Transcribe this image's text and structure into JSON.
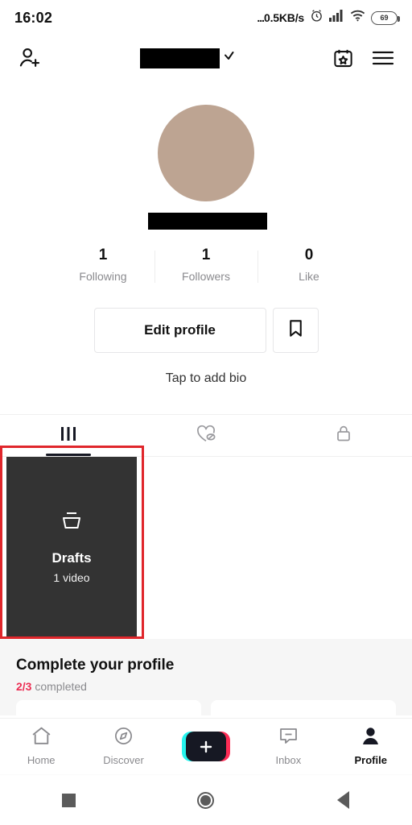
{
  "status_bar": {
    "time": "16:02",
    "dots": "...",
    "network_speed": "0.5KB/s",
    "battery_level": "69",
    "icons": [
      "alarm-clock-icon",
      "signal-bars-icon",
      "wifi-icon",
      "battery-icon"
    ]
  },
  "header": {
    "add_friends_icon": "add-person-icon",
    "username_redacted": "",
    "chevron": "chevron-down-icon",
    "events_icon": "calendar-star-icon",
    "menu_icon": "hamburger-menu-icon"
  },
  "profile": {
    "avatar_color": "#bda492",
    "handle_redacted": "",
    "stats": [
      {
        "value": "1",
        "label": "Following"
      },
      {
        "value": "1",
        "label": "Followers"
      },
      {
        "value": "0",
        "label": "Like"
      }
    ],
    "edit_profile_label": "Edit profile",
    "bookmark_icon": "bookmark-icon",
    "bio_placeholder": "Tap to add bio"
  },
  "tabs": [
    {
      "name": "posts",
      "icon": "grid-icon",
      "active": true
    },
    {
      "name": "liked-private",
      "icon": "heart-eye-slash-icon",
      "active": false
    },
    {
      "name": "private",
      "icon": "lock-icon",
      "active": false
    }
  ],
  "content": {
    "draft_tile": {
      "icon": "drafts-tray-icon",
      "title": "Drafts",
      "subtitle": "1 video",
      "background": "#333333"
    },
    "highlight_color": "#e0262b"
  },
  "complete_profile": {
    "title": "Complete your profile",
    "progress": "2/3",
    "progress_word": "completed",
    "progress_color": "#ec2d53"
  },
  "bottom_nav": [
    {
      "label": "Home",
      "icon": "home-icon",
      "active": false
    },
    {
      "label": "Discover",
      "icon": "compass-icon",
      "active": false
    },
    {
      "label": "",
      "icon": "create-plus-icon",
      "active": false
    },
    {
      "label": "Inbox",
      "icon": "message-icon",
      "active": false
    },
    {
      "label": "Profile",
      "icon": "person-icon",
      "active": true
    }
  ],
  "system_nav": [
    {
      "name": "recents-button",
      "icon": "square-icon"
    },
    {
      "name": "home-button",
      "icon": "circle-icon"
    },
    {
      "name": "back-button",
      "icon": "triangle-left-icon"
    }
  ]
}
